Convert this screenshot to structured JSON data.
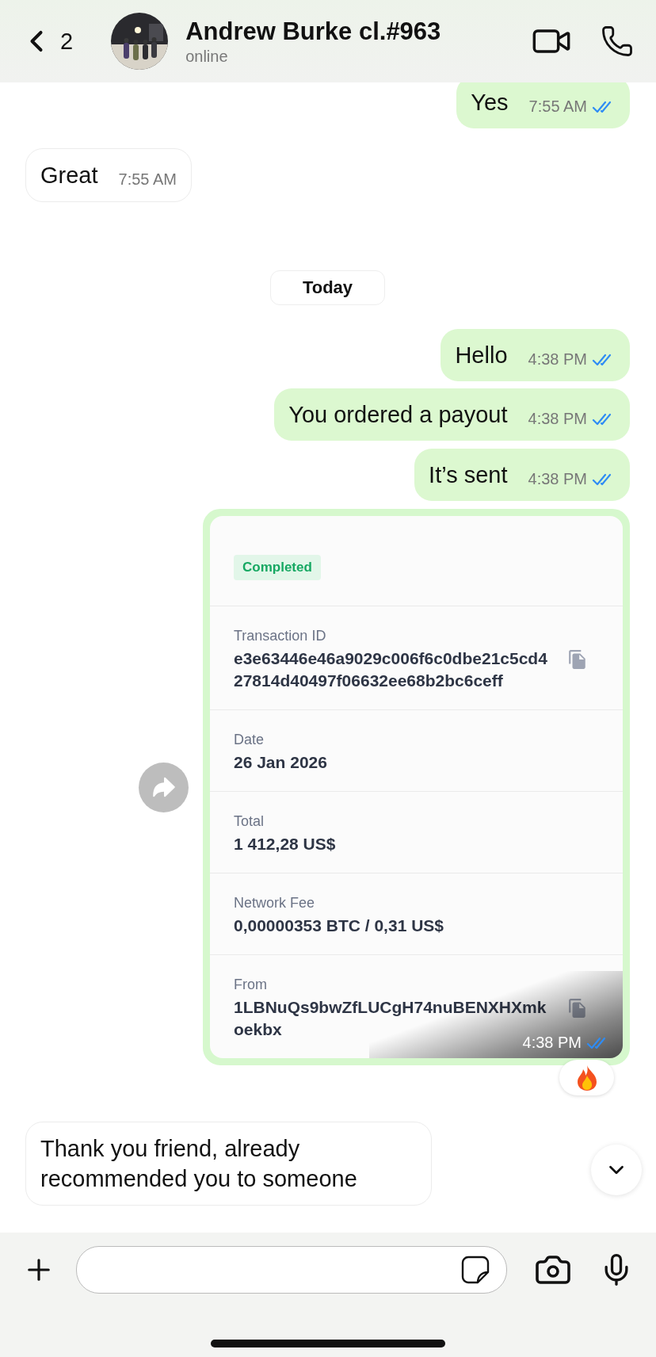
{
  "header": {
    "back_count": "2",
    "name": "Andrew Burke cl.#963",
    "status": "online"
  },
  "messages": [
    {
      "kind": "outgoing",
      "text": "Yes",
      "time": "7:55 AM",
      "read": true
    },
    {
      "kind": "incoming",
      "text": "Great",
      "time": "7:55 AM"
    },
    {
      "kind": "date",
      "text": "Today"
    },
    {
      "kind": "outgoing",
      "text": "Hello",
      "time": "4:38 PM",
      "read": true
    },
    {
      "kind": "outgoing",
      "text": "You ordered a payout",
      "time": "4:38 PM",
      "read": true
    },
    {
      "kind": "outgoing",
      "text": "It’s sent",
      "time": "4:38 PM",
      "read": true
    },
    {
      "kind": "transaction",
      "status": "Completed",
      "time": "4:38 PM",
      "read": true,
      "reaction": {
        "kind": "fire"
      },
      "fields": [
        {
          "label": "Transaction ID",
          "value": "e3e63446e46a9029c006f6c0dbe21c5cd427814d40497f06632ee68b2bc6ceff",
          "copyable": true
        },
        {
          "label": "Date",
          "value": "26 Jan 2026",
          "copyable": false
        },
        {
          "label": "Total",
          "value": "1 412,28 US$",
          "copyable": false
        },
        {
          "label": "Network Fee",
          "value": "0,00000353 BTC / 0,31 US$",
          "copyable": false
        },
        {
          "label": "From",
          "value": "1LBNuQs9bwZfLUCgH74nuBENXHXmkoekbx",
          "copyable": true
        }
      ]
    },
    {
      "kind": "incoming",
      "text": "Thank you friend, already recommended you to someone"
    }
  ]
}
